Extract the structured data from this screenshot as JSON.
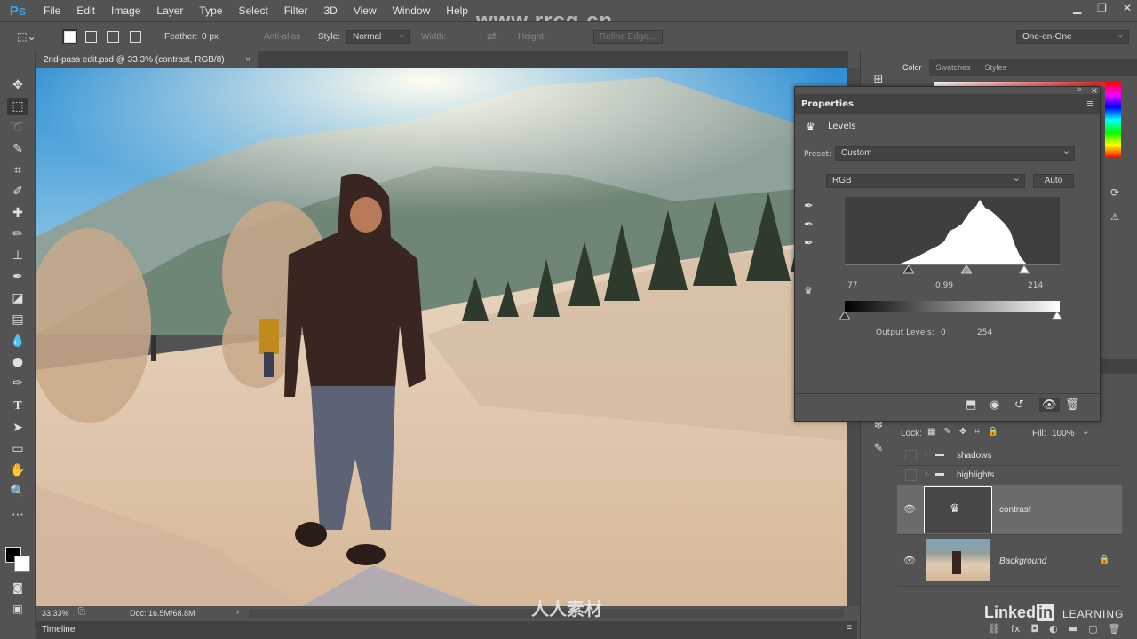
{
  "app": {
    "logo": "Ps",
    "watermark": "www.rrcg.cn",
    "menu": [
      "File",
      "Edit",
      "Image",
      "Layer",
      "Type",
      "Select",
      "Filter",
      "3D",
      "View",
      "Window",
      "Help"
    ]
  },
  "options": {
    "feather_label": "Feather:",
    "feather_value": "0 px",
    "antialias_label": "Anti-alias",
    "style_label": "Style:",
    "style_value": "Normal",
    "width_label": "Width:",
    "height_label": "Height:",
    "refine_edge_label": "Refine Edge...",
    "workspace_value": "One-on-One"
  },
  "document": {
    "tab_title": "2nd-pass edit.psd @ 33.3% (contrast, RGB/8)",
    "zoom": "33.33%",
    "doc_size": "Doc: 16.5M/68.8M"
  },
  "timeline": {
    "label": "Timeline"
  },
  "panel_tabs": {
    "color": "Color",
    "swatches": "Swatches",
    "styles": "Styles"
  },
  "properties": {
    "title": "Properties",
    "adjustment": "Levels",
    "preset_label": "Preset:",
    "preset_value": "Custom",
    "channel_value": "RGB",
    "auto_label": "Auto",
    "input_black": "77",
    "input_gamma": "0.99",
    "input_white": "214",
    "output_label": "Output Levels:",
    "output_black": "0",
    "output_white": "254"
  },
  "layers": {
    "lock_label": "Lock:",
    "fill_label": "Fill:",
    "fill_value": "100%",
    "items": [
      {
        "name": "shadows",
        "type": "group"
      },
      {
        "name": "highlights",
        "type": "group"
      },
      {
        "name": "contrast",
        "type": "adjustment"
      },
      {
        "name": "Background",
        "type": "image"
      }
    ]
  },
  "branding": {
    "linkedin": "Linked",
    "learning": "LEARNING",
    "cn_watermark": "人人素材"
  },
  "colors": {
    "accent": "#31a8ff",
    "panel": "#535353",
    "dark": "#424242"
  }
}
